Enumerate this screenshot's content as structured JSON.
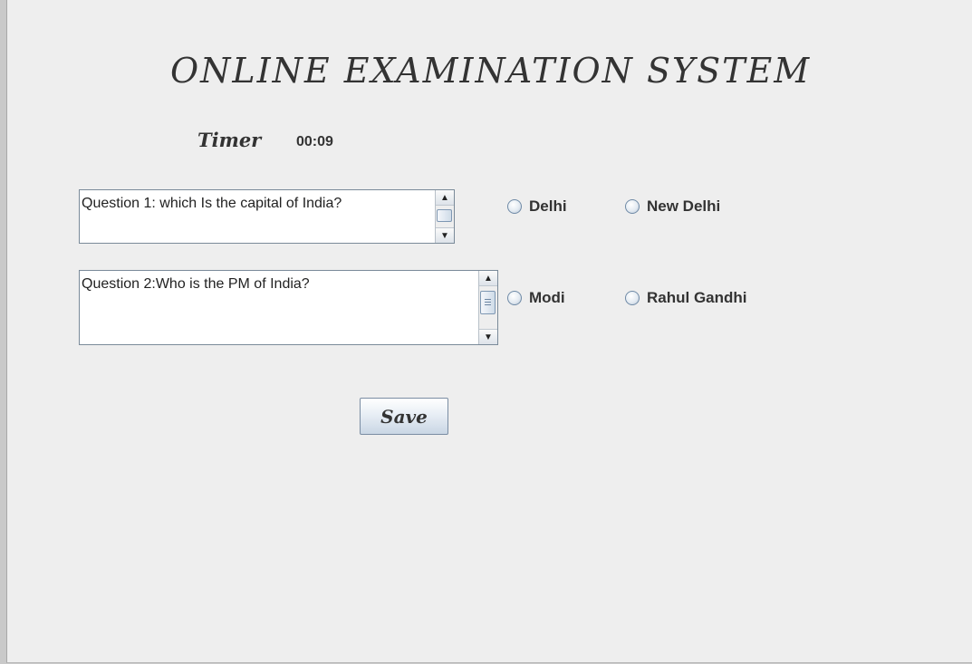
{
  "app": {
    "title": "ONLINE  EXAMINATION  SYSTEM",
    "timer_label": "Timer",
    "timer_value": "00:09"
  },
  "questions": [
    {
      "text": "Question 1: which Is the capital of India?",
      "options": [
        "Delhi",
        "New Delhi"
      ]
    },
    {
      "text": "Question 2:Who is the PM of India?",
      "options": [
        "Modi",
        "Rahul Gandhi"
      ]
    }
  ],
  "actions": {
    "save_label": "Save"
  },
  "colors": {
    "background": "#eeeeee",
    "text": "#333333",
    "border": "#7a8a99"
  },
  "icons": [
    "scroll-up-arrow-icon",
    "scroll-down-arrow-icon"
  ]
}
